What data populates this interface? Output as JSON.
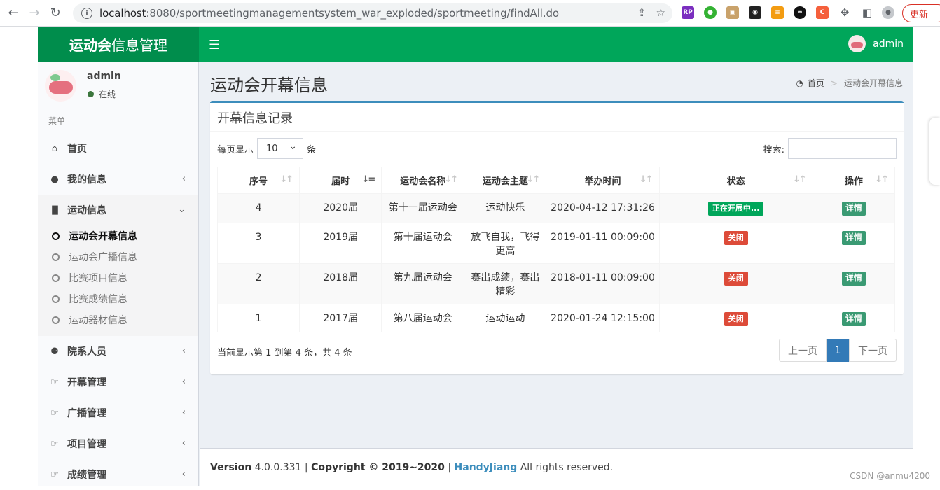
{
  "browser": {
    "url_host": "localhost",
    "url_rest": ":8080/sportmeetingmanagementsystem_war_exploded/sportmeeting/findAll.do",
    "update_label": "更新",
    "ext_rp": "RP"
  },
  "header": {
    "logo_bold": "运动会",
    "logo_rest": "信息管理",
    "user": "admin"
  },
  "sidebar": {
    "user_name": "admin",
    "status": "在线",
    "menu_header": "菜单",
    "items": [
      {
        "label": "首页",
        "icon": "home-icon"
      },
      {
        "label": "我的信息",
        "icon": "user-icon"
      },
      {
        "label": "运动信息",
        "icon": "bar-chart-icon"
      },
      {
        "label": "院系人员",
        "icon": "users-icon"
      },
      {
        "label": "开幕管理",
        "icon": "hand-pointer-icon"
      },
      {
        "label": "广播管理",
        "icon": "hand-pointer-icon"
      },
      {
        "label": "项目管理",
        "icon": "hand-pointer-icon"
      },
      {
        "label": "成绩管理",
        "icon": "hand-pointer-icon"
      }
    ],
    "sub_items": [
      "运动会开幕信息",
      "运动会广播信息",
      "比赛项目信息",
      "比赛成绩信息",
      "运动器材信息"
    ]
  },
  "page": {
    "title": "运动会开幕信息",
    "breadcrumb_home": "首页",
    "breadcrumb_current": "运动会开幕信息"
  },
  "box": {
    "title": "开幕信息记录",
    "length_prefix": "每页显示",
    "length_value": "10",
    "length_suffix": "条",
    "search_label": "搜索:",
    "columns": [
      "序号",
      "届时",
      "运动会名称",
      "运动会主题",
      "举办时间",
      "状态",
      "操作"
    ],
    "rows": [
      {
        "no": "4",
        "session": "2020届",
        "name": "第十一届运动会",
        "theme": "运动快乐",
        "time": "2020-04-12 17:31:26",
        "status": "正在开展中...",
        "status_type": "ok",
        "action": "详情"
      },
      {
        "no": "3",
        "session": "2019届",
        "name": "第十届运动会",
        "theme": "放飞自我，飞得更高",
        "time": "2019-01-11 00:09:00",
        "status": "关闭",
        "status_type": "closed",
        "action": "详情"
      },
      {
        "no": "2",
        "session": "2018届",
        "name": "第九届运动会",
        "theme": "赛出成绩，赛出精彩",
        "time": "2018-01-11 00:09:00",
        "status": "关闭",
        "status_type": "closed",
        "action": "详情"
      },
      {
        "no": "1",
        "session": "2017届",
        "name": "第八届运动会",
        "theme": "运动运动",
        "time": "2020-01-24 12:15:00",
        "status": "关闭",
        "status_type": "closed",
        "action": "详情"
      }
    ],
    "info": "当前显示第 1 到第 4 条，共 4 条",
    "pager": {
      "prev": "上一页",
      "current": "1",
      "next": "下一页"
    }
  },
  "footer": {
    "version_label": "Version",
    "version": "4.0.0.331",
    "copyright": "Copyright © 2019~2020",
    "author": "HandyJiang",
    "rights": "All rights reserved."
  },
  "watermark": "CSDN @anmu4200",
  "colors": {
    "brand": "#00a65a",
    "brand_dark": "#008d4c",
    "box_border": "#3c8dbc",
    "danger": "#dd4b39",
    "pager_active": "#337ab7"
  }
}
